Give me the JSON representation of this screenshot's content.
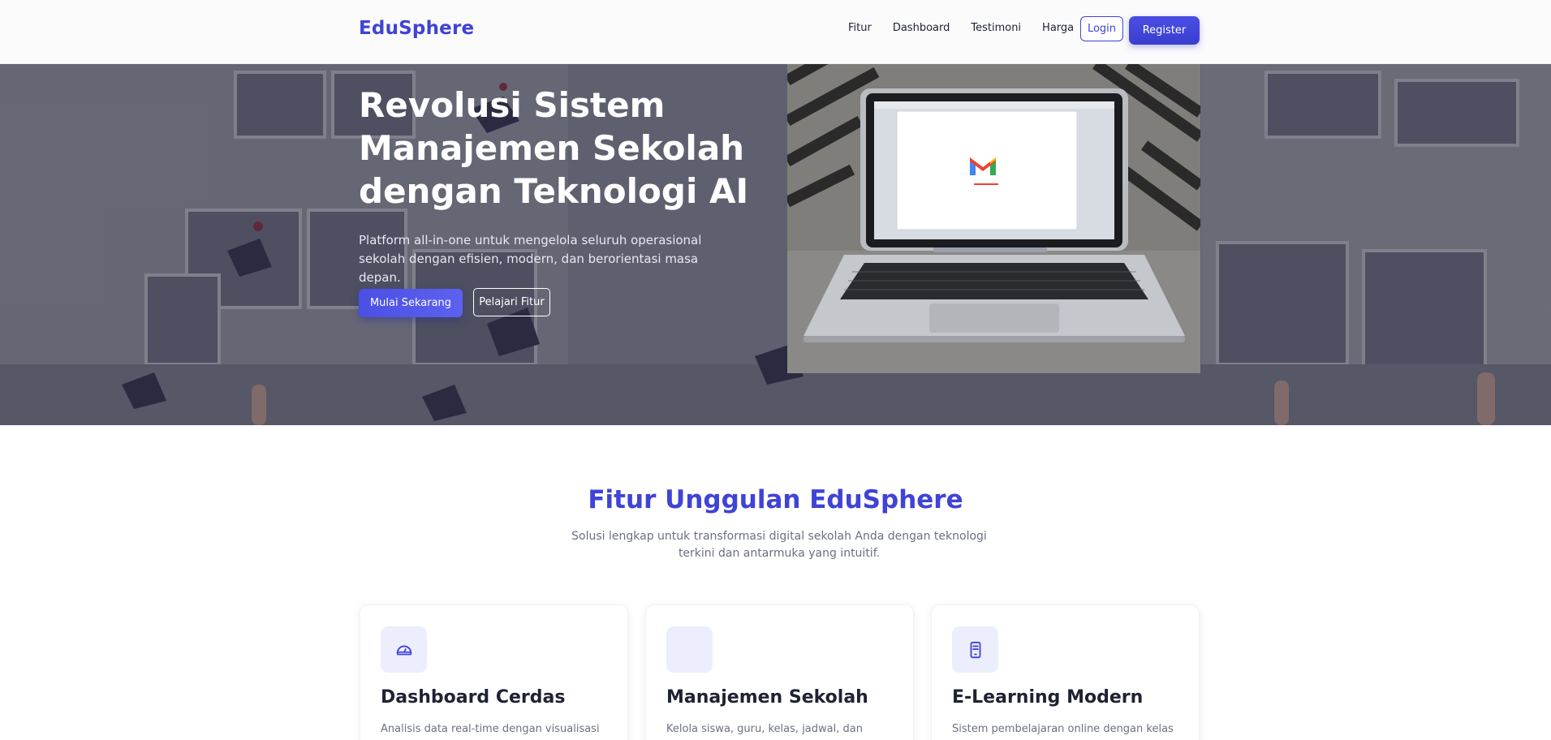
{
  "brand": "EduSphere",
  "nav": {
    "links": [
      "Fitur",
      "Dashboard",
      "Testimoni",
      "Harga"
    ],
    "login_label": "Login",
    "register_label": "Register"
  },
  "hero": {
    "title": "Revolusi Sistem Manajemen Sekolah dengan Teknologi AI",
    "subtitle": "Platform all-in-one untuk mengelola seluruh operasional sekolah dengan efisien, modern, dan berorientasi masa depan.",
    "primary_button": "Mulai Sekarang",
    "secondary_button": "Pelajari Fitur",
    "image_description": "laptop-on-carpet-photo"
  },
  "features": {
    "title": "Fitur Unggulan EduSphere",
    "subtitle": "Solusi lengkap untuk transformasi digital sekolah Anda dengan teknologi terkini dan antarmuka yang intuitif.",
    "cards": [
      {
        "icon": "gauge-icon",
        "title": "Dashboard Cerdas",
        "desc": "Analisis data real-time dengan visualisasi interaktif untuk pengambilan keputusan"
      },
      {
        "icon": "",
        "title": "Manajemen Sekolah",
        "desc": "Kelola siswa, guru, kelas, jadwal, dan inventaris sekolah dalam satu platform terintegrasi"
      },
      {
        "icon": "tablet-icon",
        "title": "E-Learning Modern",
        "desc": "Sistem pembelajaran online dengan kelas virtual, materi interaktif, dan tugas digital terpadu"
      }
    ]
  },
  "colors": {
    "accent": "#3f43d6",
    "text": "#1f2233",
    "muted": "#6b7080"
  }
}
